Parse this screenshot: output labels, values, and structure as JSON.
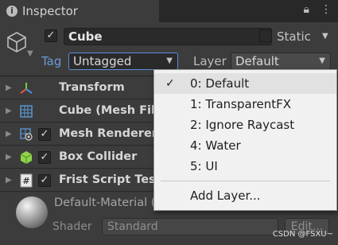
{
  "tab": {
    "title": "Inspector",
    "lock_icon": "lock-icon",
    "more_icon": "kebab-icon"
  },
  "object": {
    "name": "Cube",
    "active": true,
    "static_label": "Static",
    "static": false,
    "tag_label": "Tag",
    "tag_value": "Untagged",
    "layer_label": "Layer",
    "layer_value": "Default"
  },
  "components": [
    {
      "name": "Transform",
      "icon": "transform-icon",
      "has_checkbox": false
    },
    {
      "name": "Cube (Mesh Filter)",
      "icon": "mesh-filter-icon",
      "has_checkbox": false
    },
    {
      "name": "Mesh Renderer",
      "icon": "mesh-renderer-icon",
      "has_checkbox": true,
      "checked": true
    },
    {
      "name": "Box Collider",
      "icon": "box-collider-icon",
      "has_checkbox": true,
      "checked": true
    },
    {
      "name": "Frist Script Test",
      "icon": "script-icon",
      "has_checkbox": true,
      "checked": true
    }
  ],
  "material": {
    "name": "Default-Material (Material)",
    "shader_label": "Shader",
    "shader_value": "Standard",
    "edit_label": "Edit..."
  },
  "layer_menu": {
    "items": [
      {
        "label": "0: Default",
        "checked": true
      },
      {
        "label": "1: TransparentFX",
        "checked": false
      },
      {
        "label": "2: Ignore Raycast",
        "checked": false
      },
      {
        "label": "4: Water",
        "checked": false
      },
      {
        "label": "5: UI",
        "checked": false
      }
    ],
    "add_layer": "Add Layer..."
  },
  "watermark": "CSDN @FSXU~",
  "colors": {
    "accent": "#5c8ed6",
    "tag_label": "#6b9bd8",
    "menu_bg": "#f1f1f1",
    "panel_bg": "#3c3c3c"
  }
}
